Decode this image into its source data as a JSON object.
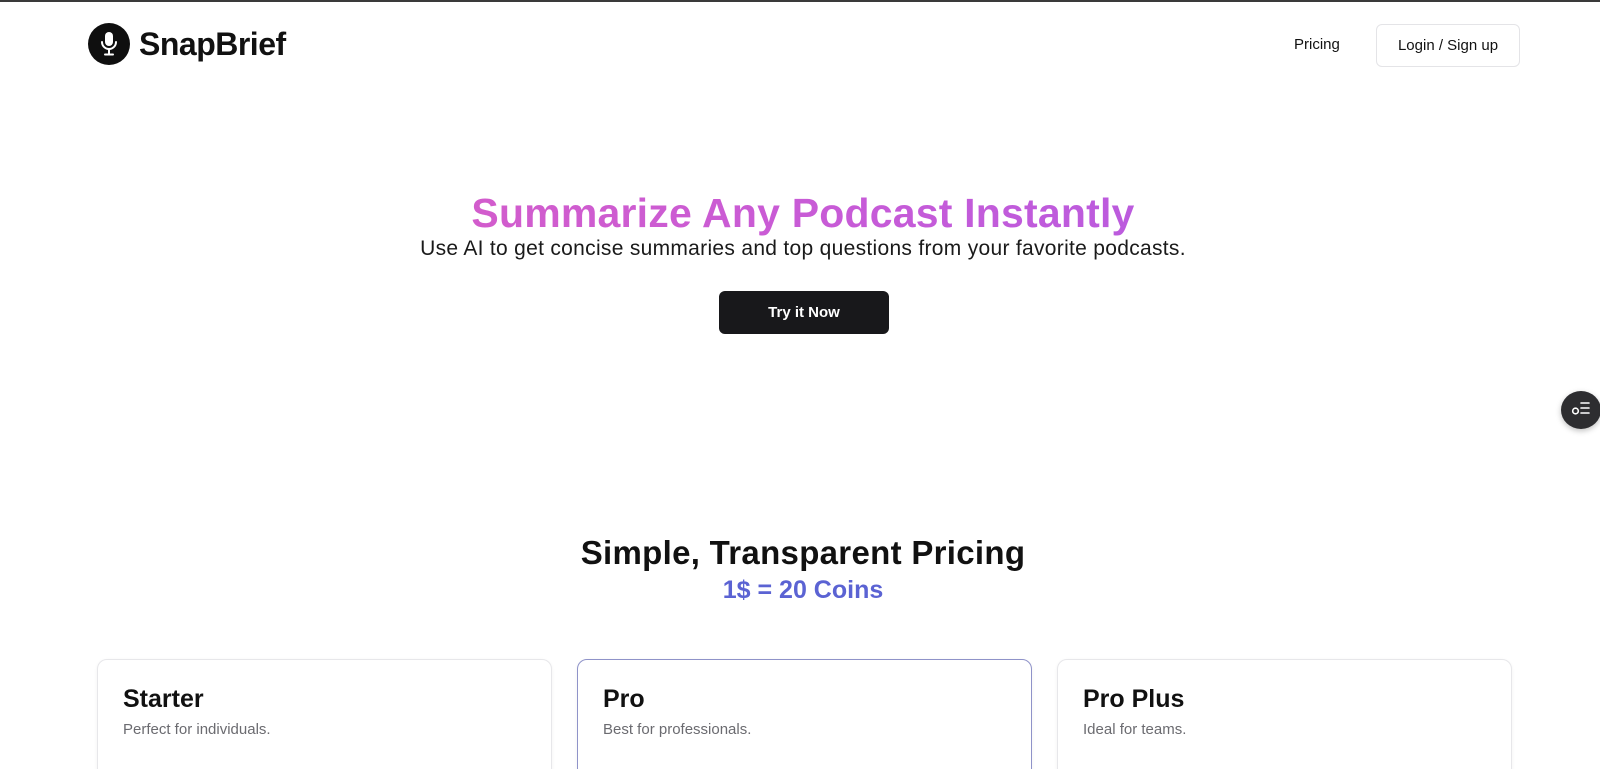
{
  "header": {
    "brand": "SnapBrief",
    "nav_pricing": "Pricing",
    "login_label": "Login / Sign up"
  },
  "hero": {
    "title": "Summarize Any Podcast Instantly",
    "subtitle": "Use AI to get concise summaries and top questions from your favorite podcasts.",
    "cta_label": "Try it Now"
  },
  "pricing": {
    "title": "Simple, Transparent Pricing",
    "subtitle": "1$ = 20 Coins",
    "plans": [
      {
        "name": "Starter",
        "description": "Perfect for individuals."
      },
      {
        "name": "Pro",
        "description": "Best for professionals."
      },
      {
        "name": "Pro Plus",
        "description": "Ideal for teams."
      }
    ]
  },
  "icons": {
    "logo": "microphone-icon",
    "floating_widget": "filter-list-icon"
  },
  "colors": {
    "hero_gradient_start": "#e05dbf",
    "hero_gradient_end": "#a85be8",
    "coins_accent": "#5b63d3",
    "cta_background": "#18181b",
    "pro_card_border": "#8f93c9"
  }
}
